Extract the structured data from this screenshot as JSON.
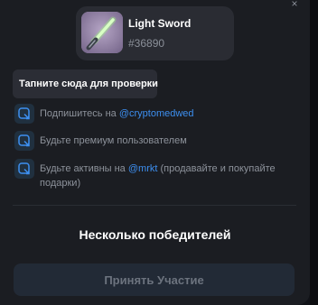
{
  "close_glyph": "×",
  "prize": {
    "name": "Light Sword",
    "id": "#36890",
    "icon": "light-sword-icon"
  },
  "tooltip": "Тапните сюда для проверки",
  "requirements": [
    {
      "icon": "check-square-icon",
      "prefix": "Подпишитесь на ",
      "link": "@cryptomedwed",
      "suffix": ""
    },
    {
      "icon": "check-square-icon",
      "prefix": "Будьте премиум пользователем",
      "link": "",
      "suffix": ""
    },
    {
      "icon": "check-square-icon",
      "prefix": "Будьте активны на ",
      "link": "@mrkt",
      "suffix": " (продавайте и покупайте подарки)"
    }
  ],
  "winners_label": "Несколько победителей",
  "participate_label": "Принять Участие",
  "colors": {
    "background": "#1b1d22",
    "accent_link": "#3d8ff0",
    "button_bg": "#222a36",
    "icon_bg": "#20303f"
  }
}
